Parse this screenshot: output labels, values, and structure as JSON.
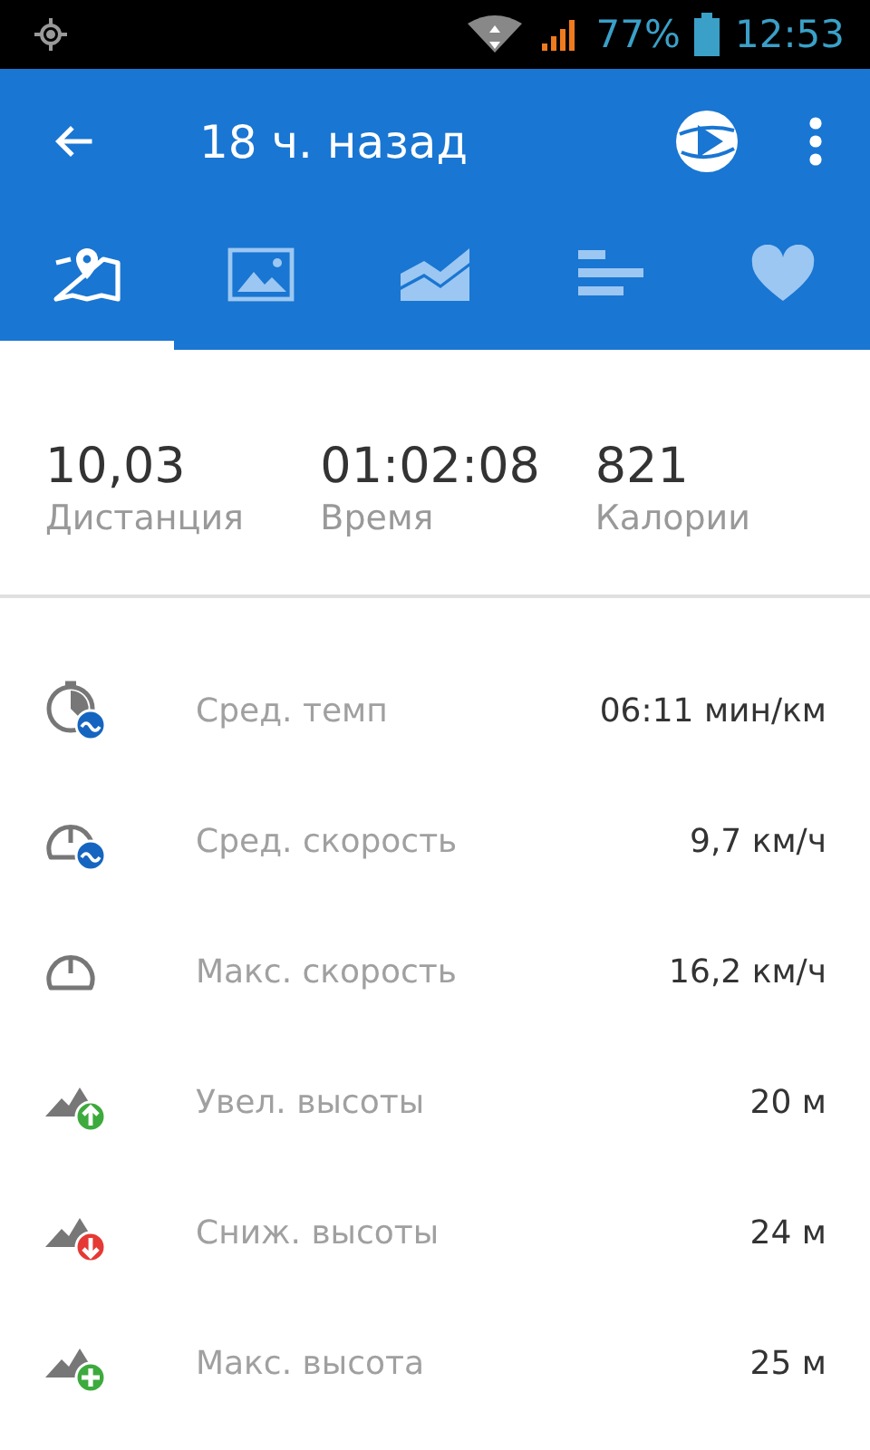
{
  "status_bar": {
    "battery": "77%",
    "time": "12:53"
  },
  "toolbar": {
    "title": "18 ч. назад"
  },
  "tabs": [
    {
      "kind": "map",
      "selected": true
    },
    {
      "kind": "photos",
      "selected": false
    },
    {
      "kind": "graph",
      "selected": false
    },
    {
      "kind": "splits",
      "selected": false
    },
    {
      "kind": "heart",
      "selected": false
    }
  ],
  "summary": [
    {
      "value": "10,03",
      "label": "Дистанция"
    },
    {
      "value": "01:02:08",
      "label": "Время"
    },
    {
      "value": "821",
      "label": "Калории"
    }
  ],
  "stats": [
    {
      "kind": "pace",
      "label": "Сред. темп",
      "value": "06:11 мин/км"
    },
    {
      "kind": "avg_speed",
      "label": "Сред. скорость",
      "value": "9,7 км/ч"
    },
    {
      "kind": "max_speed",
      "label": "Макс. скорость",
      "value": "16,2 км/ч"
    },
    {
      "kind": "elev_gain",
      "label": "Увел. высоты",
      "value": "20 м"
    },
    {
      "kind": "elev_loss",
      "label": "Сниж. высоты",
      "value": "24 м"
    },
    {
      "kind": "elev_max",
      "label": "Макс. высота",
      "value": "25 м"
    }
  ]
}
